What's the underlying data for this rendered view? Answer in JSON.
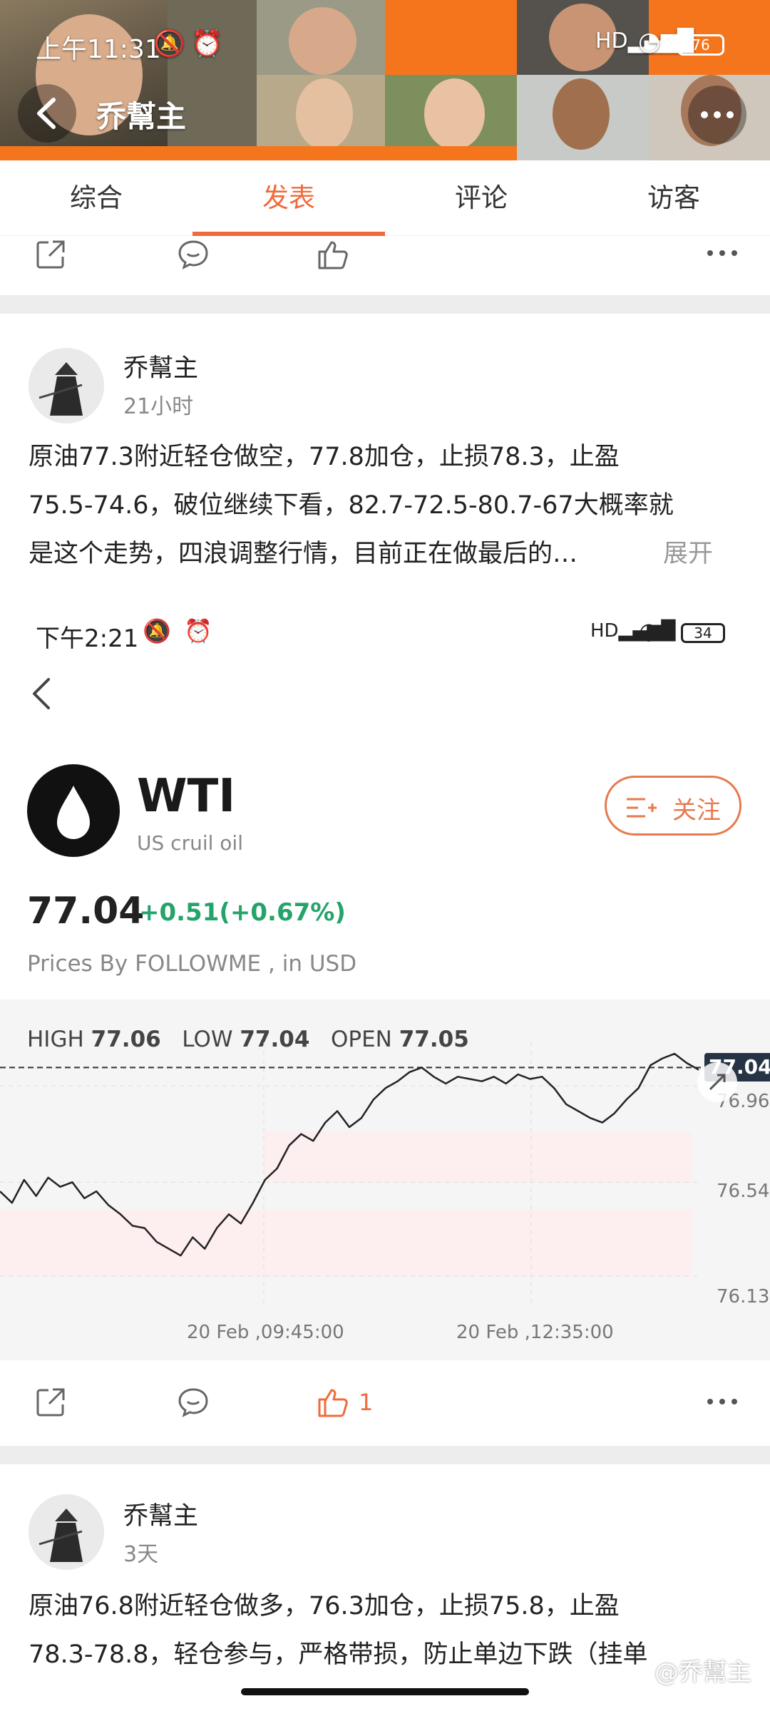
{
  "status_bar": {
    "time": "上午11:31",
    "battery": "76"
  },
  "header": {
    "title": "乔幫主"
  },
  "tabs": [
    {
      "label": "综合"
    },
    {
      "label": "发表"
    },
    {
      "label": "评论"
    },
    {
      "label": "访客"
    }
  ],
  "posts": [
    {
      "author": "乔幫主",
      "time": "21小时",
      "lines": [
        "原油77.3附近轻仓做空，77.8加仓，止损78.3，止盈",
        "75.5-74.6，破位继续下看，82.7-72.5-80.7-67大概率就",
        "是这个走势，四浪调整行情，目前正在做最后的…"
      ],
      "expand_label": "展开",
      "like_count": "1"
    },
    {
      "author": "乔幫主",
      "time": "3天",
      "lines": [
        "原油76.8附近轻仓做多，76.3加仓，止损75.8，止盈",
        "78.3-78.8，轻仓参与，严格带损，防止单边下跌（挂单"
      ]
    }
  ],
  "embedded": {
    "status_time": "下午2:21",
    "battery": "34",
    "symbol": "WTI",
    "name": "US cruil oil",
    "follow_label": "关注",
    "price": "77.04",
    "change": "+0.51(+0.67%)",
    "source": "Prices By FOLLOWME , in USD",
    "high_label": "HIGH",
    "high": "77.06",
    "low_label": "LOW",
    "low": "77.04",
    "open_label": "OPEN",
    "open": "77.05",
    "current_tag": "77.04",
    "y_ticks": [
      "76.96",
      "76.54",
      "76.13"
    ],
    "x_ticks": [
      "20 Feb ,09:45:00",
      "20 Feb ,12:35:00"
    ]
  },
  "chart_data": {
    "type": "line",
    "ylim": [
      76.0,
      77.15
    ],
    "y_ticks": [
      76.96,
      76.54,
      76.13
    ],
    "x_ticks": [
      "20 Feb ,09:45:00",
      "20 Feb ,12:35:00"
    ],
    "current": 77.04,
    "values": [
      76.5,
      76.45,
      76.55,
      76.48,
      76.56,
      76.52,
      76.54,
      76.47,
      76.5,
      76.44,
      76.4,
      76.35,
      76.34,
      76.28,
      76.25,
      76.22,
      76.3,
      76.25,
      76.34,
      76.4,
      76.36,
      76.45,
      76.55,
      76.6,
      76.7,
      76.75,
      76.72,
      76.8,
      76.85,
      76.78,
      76.82,
      76.9,
      76.95,
      76.98,
      77.02,
      77.04,
      77.0,
      76.97,
      77.0,
      76.99,
      76.98,
      77.0,
      76.97,
      77.01,
      76.99,
      77.0,
      76.95,
      76.88,
      76.85,
      76.82,
      76.8,
      76.84,
      76.9,
      76.95,
      77.05,
      77.08,
      77.1,
      77.06,
      77.03
    ],
    "series_color": "#222222"
  },
  "watermark": "@乔幫主",
  "colors": {
    "accent": "#f06b3b",
    "up": "#24a36a"
  }
}
